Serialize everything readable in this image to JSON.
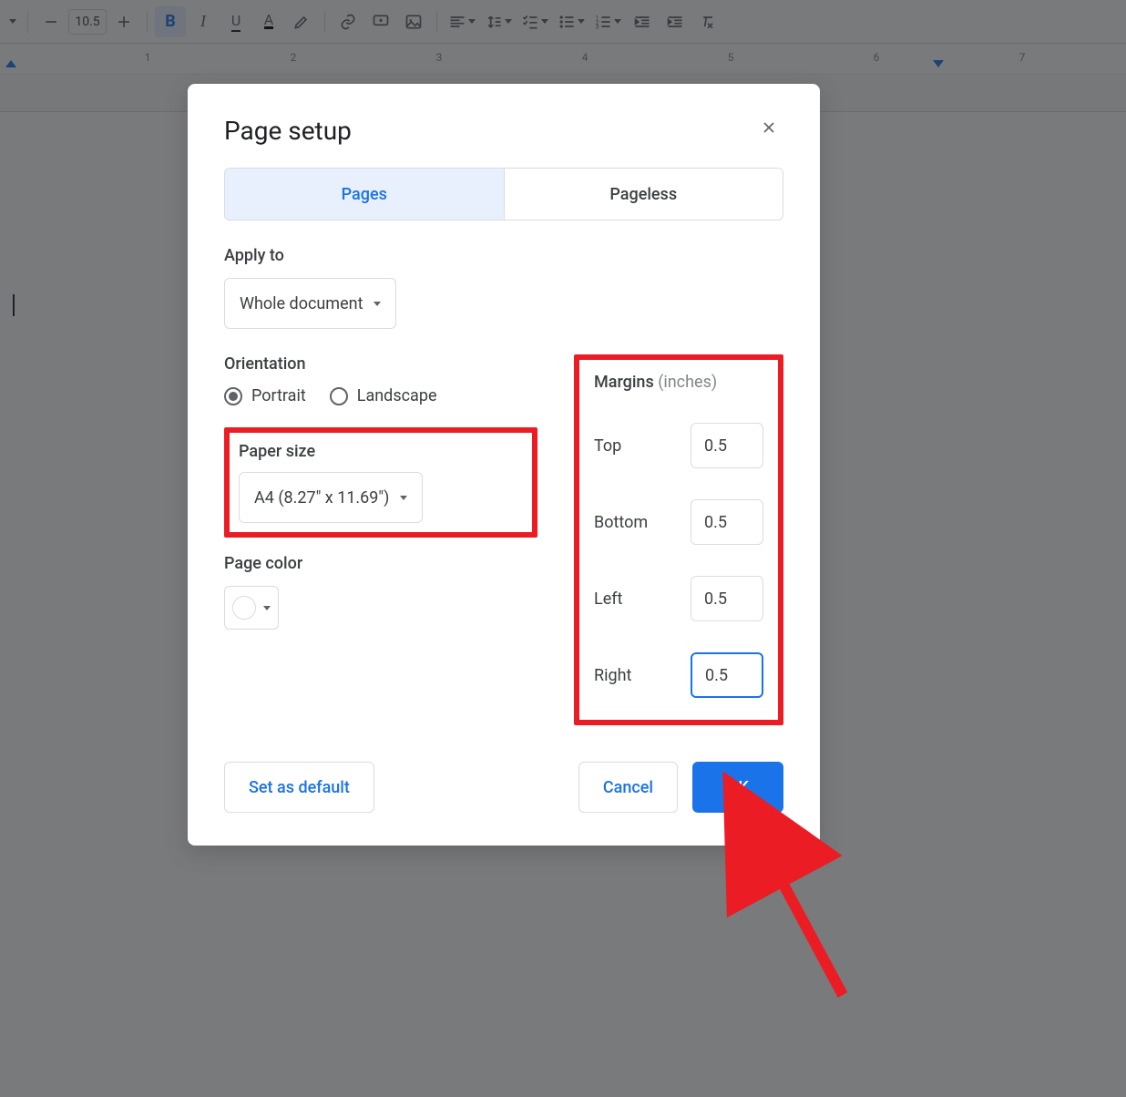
{
  "toolbar": {
    "font_size": "10.5"
  },
  "ruler": {
    "marks": [
      "1",
      "2",
      "3",
      "4",
      "5",
      "6",
      "7"
    ]
  },
  "dialog": {
    "title": "Page setup",
    "tabs": {
      "pages": "Pages",
      "pageless": "Pageless"
    },
    "apply_to": {
      "label": "Apply to",
      "value": "Whole document"
    },
    "orientation": {
      "label": "Orientation",
      "portrait": "Portrait",
      "landscape": "Landscape",
      "selected": "portrait"
    },
    "paper_size": {
      "label": "Paper size",
      "value": "A4 (8.27\" x 11.69\")"
    },
    "page_color": {
      "label": "Page color"
    },
    "margins": {
      "label": "Margins",
      "unit": "(inches)",
      "top": {
        "label": "Top",
        "value": "0.5"
      },
      "bottom": {
        "label": "Bottom",
        "value": "0.5"
      },
      "left": {
        "label": "Left",
        "value": "0.5"
      },
      "right": {
        "label": "Right",
        "value": "0.5"
      }
    },
    "buttons": {
      "set_default": "Set as default",
      "cancel": "Cancel",
      "ok": "OK"
    }
  }
}
